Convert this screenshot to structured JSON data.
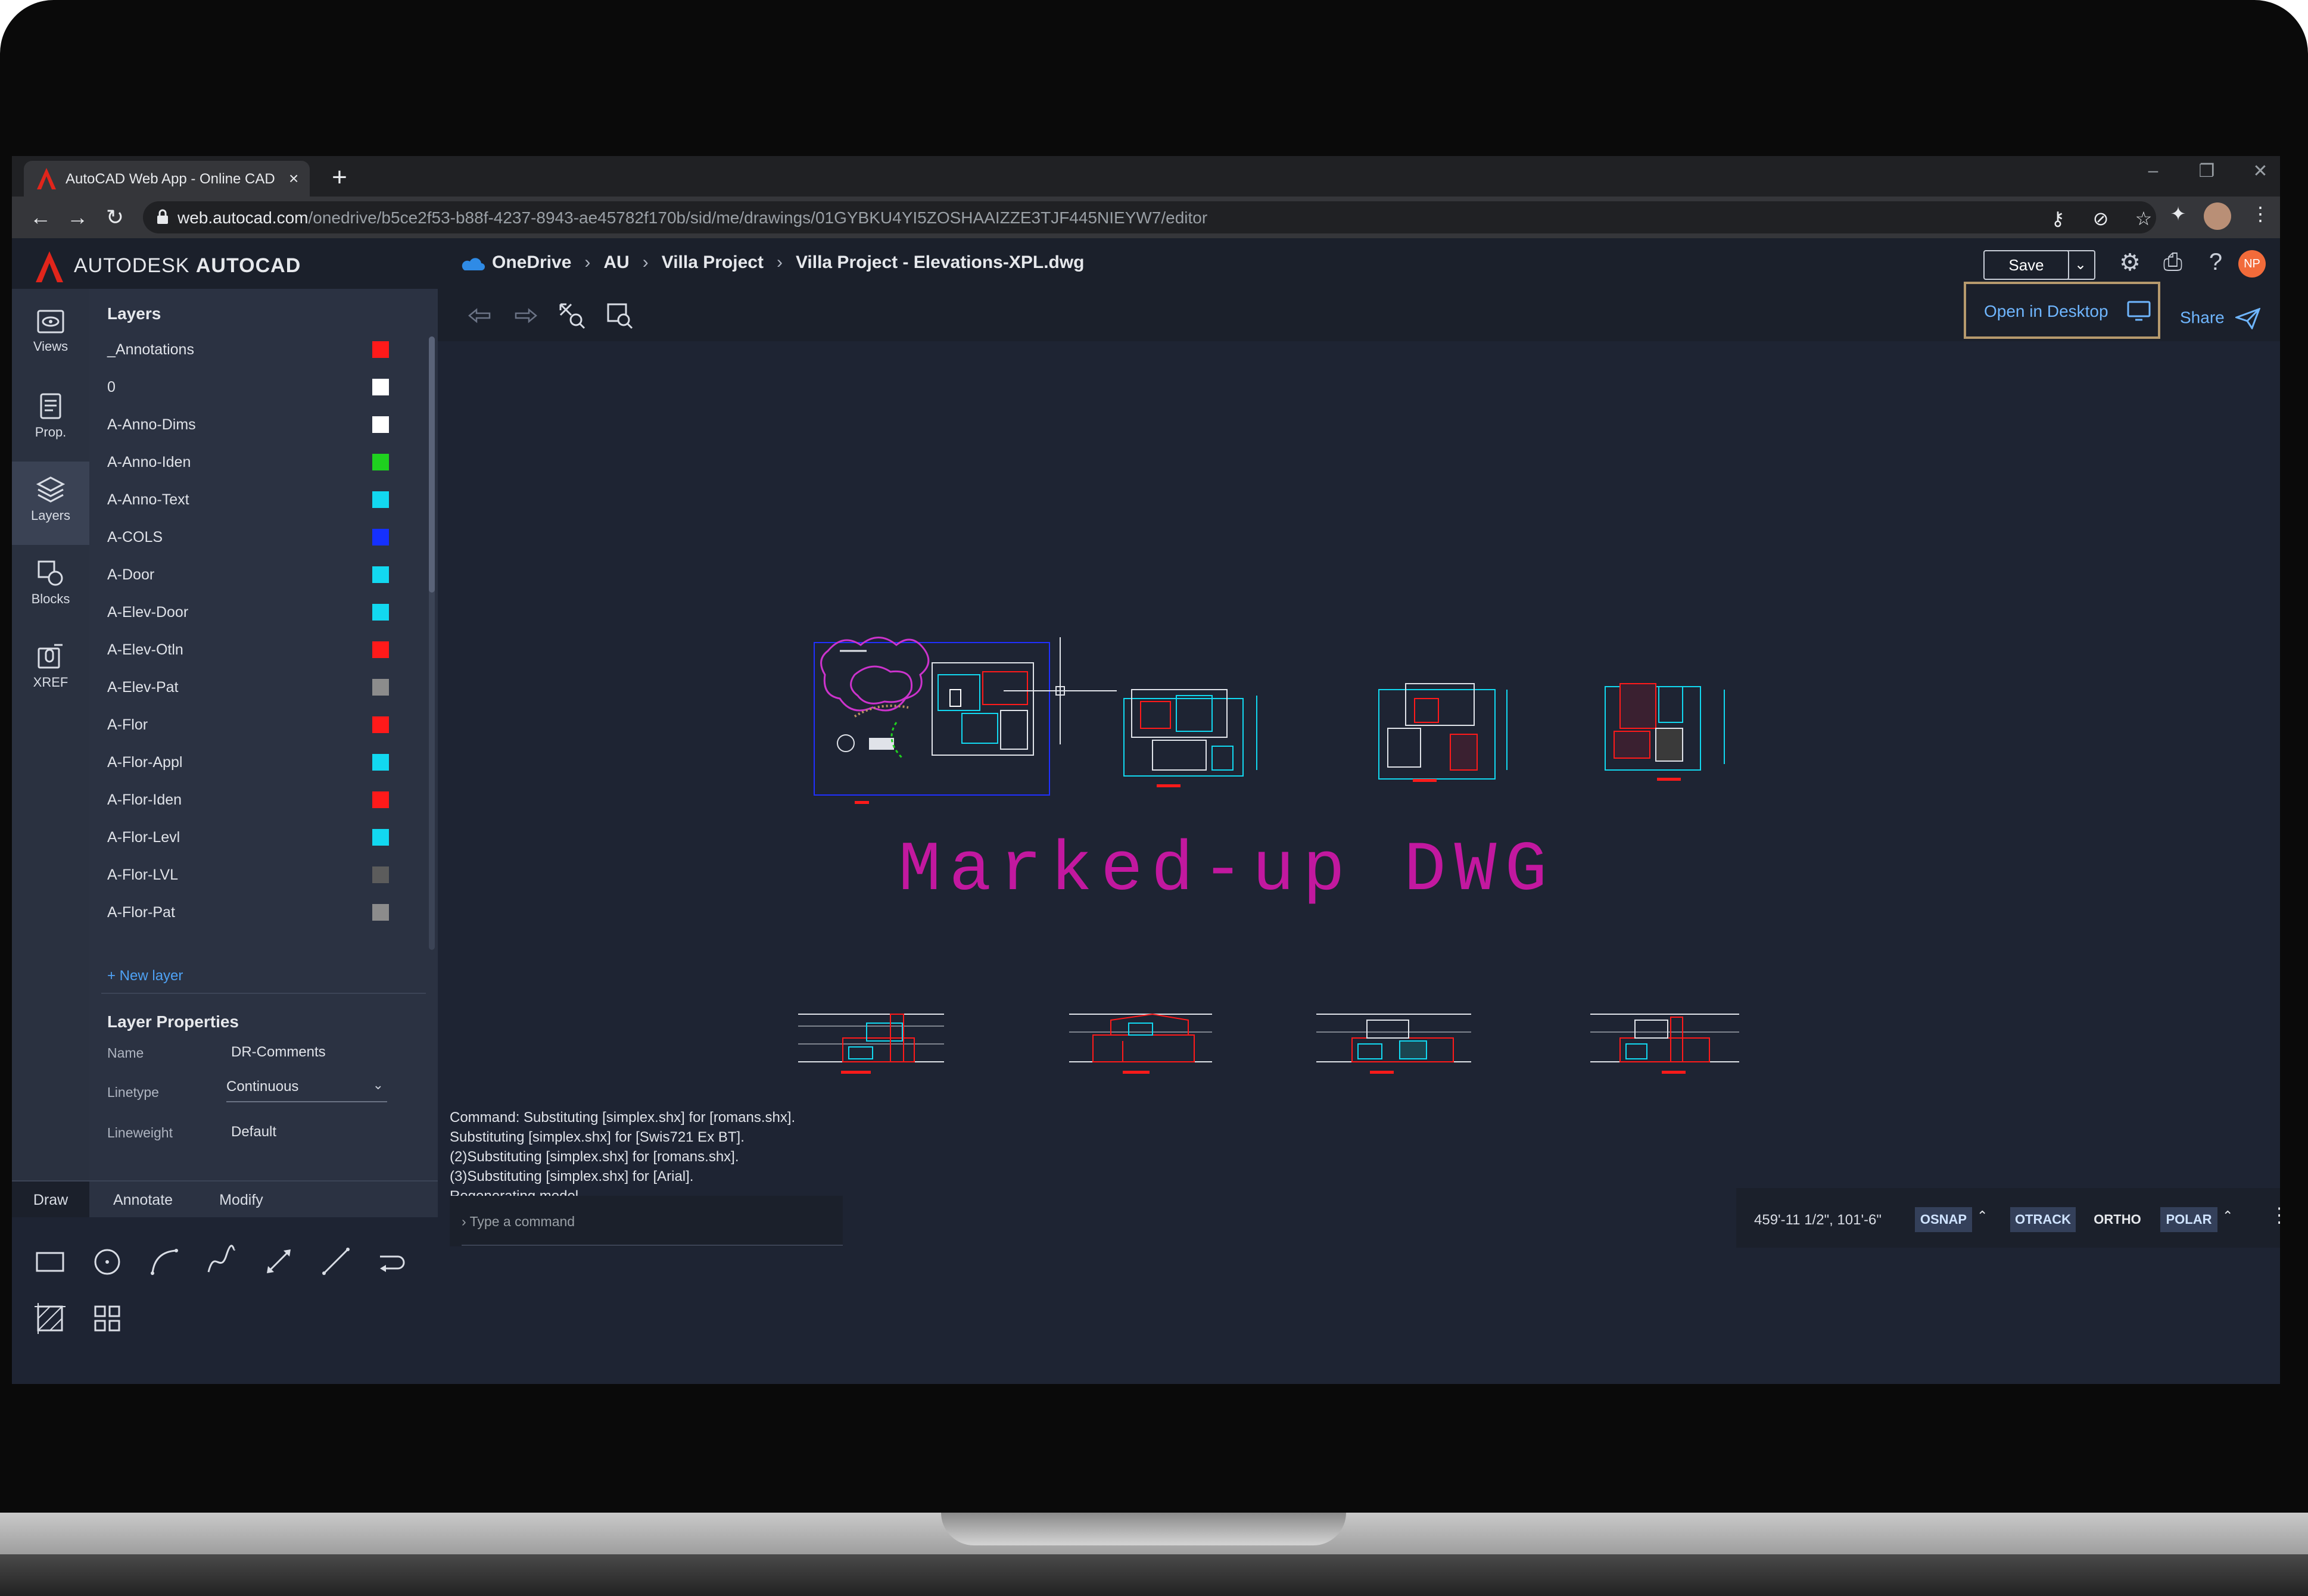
{
  "browser": {
    "tab_title": "AutoCAD Web App - Online CAD",
    "tab_close": "×",
    "new_tab": "+",
    "url_host": "web.autocad.com",
    "url_path": "/onedrive/b5ce2f53-b88f-4237-8943-ae45782f170b/sid/me/drawings/01GYBKU4YI5ZOSHAAIZZE3TJF445NIEYW7/editor",
    "window_controls": [
      "–",
      "❐",
      "✕"
    ]
  },
  "app": {
    "brand": "AUTODESK",
    "product": "AUTOCAD",
    "breadcrumbs": [
      "OneDrive",
      "AU",
      "Villa Project",
      "Villa Project - Elevations-XPL.dwg"
    ],
    "save_label": "Save",
    "user_initials": "NP",
    "open_in_desktop": "Open in Desktop",
    "share": "Share"
  },
  "rail": [
    {
      "label": "Views",
      "icon": "eye-icon"
    },
    {
      "label": "Prop.",
      "icon": "properties-icon"
    },
    {
      "label": "Layers",
      "icon": "layers-icon"
    },
    {
      "label": "Blocks",
      "icon": "blocks-icon"
    },
    {
      "label": "XREF",
      "icon": "xref-icon"
    }
  ],
  "layers_panel": {
    "title": "Layers",
    "layers": [
      {
        "name": "_Annotations",
        "color": "#ff1a1a"
      },
      {
        "name": "0",
        "color": "#ffffff"
      },
      {
        "name": "A-Anno-Dims",
        "color": "#ffffff"
      },
      {
        "name": "A-Anno-Iden",
        "color": "#1fd11f"
      },
      {
        "name": "A-Anno-Text",
        "color": "#12d8f0"
      },
      {
        "name": "A-COLS",
        "color": "#1530ff"
      },
      {
        "name": "A-Door",
        "color": "#12d8f0"
      },
      {
        "name": "A-Elev-Door",
        "color": "#12d8f0"
      },
      {
        "name": "A-Elev-Otln",
        "color": "#ff1a1a"
      },
      {
        "name": "A-Elev-Pat",
        "color": "#8c8c8c"
      },
      {
        "name": "A-Flor",
        "color": "#ff1a1a"
      },
      {
        "name": "A-Flor-Appl",
        "color": "#12d8f0"
      },
      {
        "name": "A-Flor-Iden",
        "color": "#ff1a1a"
      },
      {
        "name": "A-Flor-Levl",
        "color": "#12d8f0"
      },
      {
        "name": "A-Flor-LVL",
        "color": "#5c5c5c"
      },
      {
        "name": "A-Flor-Pat",
        "color": "#8c8c8c"
      }
    ],
    "new_layer": "+ New layer"
  },
  "layer_properties": {
    "title": "Layer Properties",
    "name_label": "Name",
    "name_value": "DR-Comments",
    "linetype_label": "Linetype",
    "linetype_value": "Continuous",
    "lineweight_label": "Lineweight",
    "lineweight_value": "Default"
  },
  "tool_tabs": [
    "Draw",
    "Annotate",
    "Modify"
  ],
  "drawing": {
    "markup_text": "Marked-up DWG"
  },
  "command_history": [
    "Command: Substituting [simplex.shx] for [romans.shx].",
    "Substituting [simplex.shx] for [Swis721 Ex BT].",
    "(2)Substituting [simplex.shx] for [romans.shx].",
    "(3)Substituting [simplex.shx] for [Arial].",
    "Regenerating model."
  ],
  "command_placeholder": "Type a command",
  "status": {
    "coords": "459'-11 1/2\", 101'-6\"",
    "osnap": "OSNAP",
    "otrack": "OTRACK",
    "ortho": "ORTHO",
    "polar": "POLAR"
  },
  "colors": {
    "accent_blue": "#6fb6ff",
    "highlight_border": "#b69a6d",
    "markup_magenta": "#c2189f",
    "canvas_bg": "#1e2433"
  }
}
